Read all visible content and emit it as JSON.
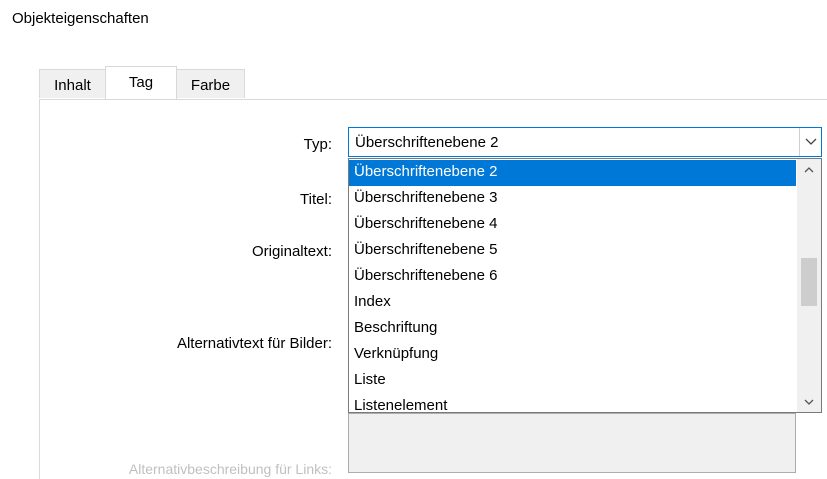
{
  "dialog": {
    "title": "Objekteigenschaften"
  },
  "tabs": [
    {
      "label": "Inhalt",
      "active": false
    },
    {
      "label": "Tag",
      "active": true
    },
    {
      "label": "Farbe",
      "active": false
    }
  ],
  "form": {
    "type_label": "Typ:",
    "title_label": "Titel:",
    "original_text_label": "Originaltext:",
    "alt_text_images_label": "Alternativtext für Bilder:",
    "alt_desc_links_label": "Alternativbeschreibung für Links:",
    "type_value": "Überschriftenebene 2"
  },
  "dropdown": {
    "options": [
      "Überschriftenebene 2",
      "Überschriftenebene 3",
      "Überschriftenebene 4",
      "Überschriftenebene 5",
      "Überschriftenebene 6",
      "Index",
      "Beschriftung",
      "Verknüpfung",
      "Liste",
      "Listenelement"
    ],
    "selected": "Überschriftenebene 2"
  },
  "colors": {
    "accent": "#0078d7",
    "selected_text": "#ffffff"
  },
  "icons": {
    "select_arrow": "chevron-down-icon",
    "scroll_up": "chevron-up-icon",
    "scroll_down": "chevron-down-icon"
  }
}
